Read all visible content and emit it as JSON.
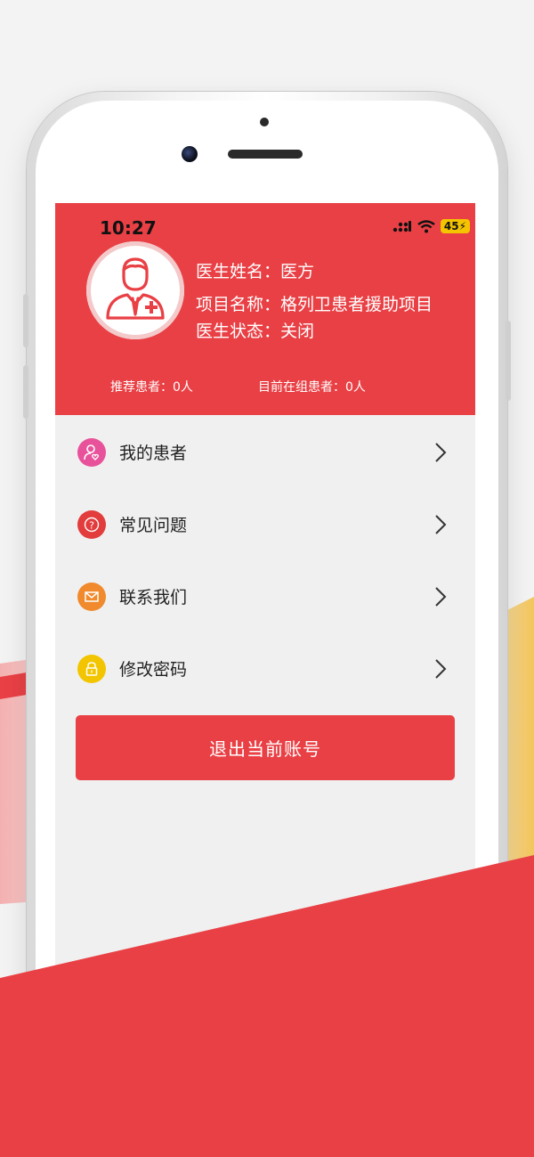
{
  "status_bar": {
    "time": "10:27",
    "battery": "45"
  },
  "profile": {
    "name_label": "医生姓名：",
    "name_value": "医方",
    "project_label": "项目名称：",
    "project_value": "格列卫患者援助项目",
    "status_label": "医生状态：",
    "status_value": "关闭"
  },
  "stats": {
    "recommended": "推荐患者：0人",
    "in_group": "目前在组患者：0人"
  },
  "menu": [
    {
      "label": "我的患者",
      "icon": "patient-icon",
      "color": "#e8529a"
    },
    {
      "label": "常见问题",
      "icon": "question-icon",
      "color": "#e23c3c"
    },
    {
      "label": "联系我们",
      "icon": "mail-icon",
      "color": "#f08a2c"
    },
    {
      "label": "修改密码",
      "icon": "lock-icon",
      "color": "#f2c500"
    }
  ],
  "logout_label": "退出当前账号",
  "colors": {
    "brand_red": "#e94045",
    "screen_bg": "#f0f0f0"
  }
}
